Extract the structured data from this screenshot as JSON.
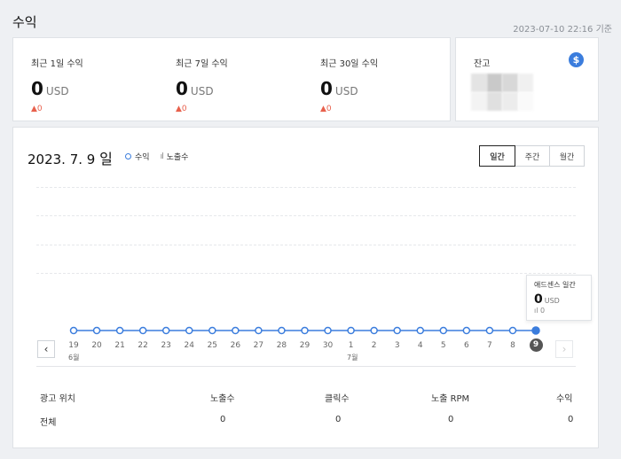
{
  "header": {
    "title": "수익",
    "timestamp": "2023-07-10 22:16 기준"
  },
  "earnings": [
    {
      "label": "최근 1일 수익",
      "value": "0",
      "unit": "USD",
      "change": "0"
    },
    {
      "label": "최근 7일 수익",
      "value": "0",
      "unit": "USD",
      "change": "0"
    },
    {
      "label": "최근 30일 수익",
      "value": "0",
      "unit": "USD",
      "change": "0"
    }
  ],
  "balance": {
    "label": "잔고",
    "icon": "dollar-icon"
  },
  "chart": {
    "date_number": "2023. 7. 9",
    "date_suffix": "일",
    "legend": {
      "revenue": "수익",
      "impressions": "노출수"
    },
    "tabs": [
      "일간",
      "주간",
      "월간"
    ],
    "active_tab": "일간",
    "tooltip": {
      "title": "애드센스 일간",
      "value": "0",
      "unit": "USD",
      "impressions": "0"
    },
    "months": [
      "6월",
      "7월"
    ]
  },
  "chart_data": {
    "type": "line",
    "x": [
      "19",
      "20",
      "21",
      "22",
      "23",
      "24",
      "25",
      "26",
      "27",
      "28",
      "29",
      "30",
      "1",
      "2",
      "3",
      "4",
      "5",
      "6",
      "7",
      "8",
      "9"
    ],
    "series": [
      {
        "name": "수익",
        "values": [
          0,
          0,
          0,
          0,
          0,
          0,
          0,
          0,
          0,
          0,
          0,
          0,
          0,
          0,
          0,
          0,
          0,
          0,
          0,
          0,
          0
        ]
      }
    ],
    "colors": {
      "line": "#3b7ddd"
    },
    "grid": true
  },
  "table": {
    "headers": [
      "광고 위치",
      "노출수",
      "클릭수",
      "노출 RPM",
      "수익"
    ],
    "rows": [
      [
        "전체",
        "0",
        "0",
        "0",
        "0"
      ]
    ]
  }
}
